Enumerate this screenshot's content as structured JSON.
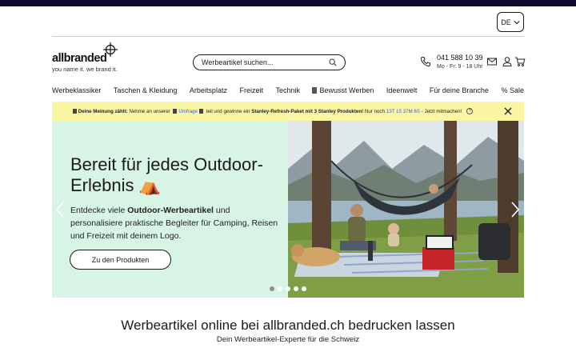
{
  "language": {
    "selected": "DE"
  },
  "logo": {
    "wordmark": "allbranded",
    "tagline": "you name it. we brand it."
  },
  "search": {
    "placeholder": "Werbeartikel suchen..."
  },
  "contact": {
    "phone": "041 588 10 39",
    "hours": "Mo - Fr: 9 - 18 Uhr"
  },
  "icons": {
    "phone": "phone-icon",
    "mail": "mail-icon",
    "account": "user-icon",
    "cart": "cart-icon",
    "search": "search-icon"
  },
  "nav": {
    "items": [
      "Werbeklassiker",
      "Taschen & Kleidung",
      "Arbeitsplatz",
      "Freizeit",
      "Technik",
      "Bewusst Werben",
      "Ideenwelt",
      "Für deine Branche",
      "% Sale"
    ]
  },
  "banner": {
    "lead": "Deine Meinung zählt:",
    "text1": "Nehme an unserer",
    "link": "Umfrage",
    "text2": "teil und gewinne ein",
    "prize": "Stanley-Refresh-Paket mit 3 Stanley Produkten!",
    "text3": "Nur noch",
    "countdown": "13T 15 37M 6S",
    "text4": "- Jetzt mitmachen!",
    "help": "?"
  },
  "hero": {
    "title": "Bereit für jedes Outdoor-Erlebnis ⛺",
    "desc_prefix": "Entdecke viele ",
    "desc_bold": "Outdoor-Werbeartikel",
    "desc_suffix": " und personalisiere praktische Begleiter für Camping, Reisen und Freizeit mit deinem Logo.",
    "button": "Zu den Produkten",
    "slides": 5,
    "active_slide": 1
  },
  "headline": {
    "title": "Werbeartikel online bei allbranded.ch bedrucken lassen",
    "subtitle": "Dein Werbeartikel-Experte für die Schweiz"
  },
  "colors": {
    "topbar": "#0e0b2b",
    "banner": "#fbf6a3",
    "hero_bg": "#d7f4e4",
    "link": "#3a62c7"
  }
}
